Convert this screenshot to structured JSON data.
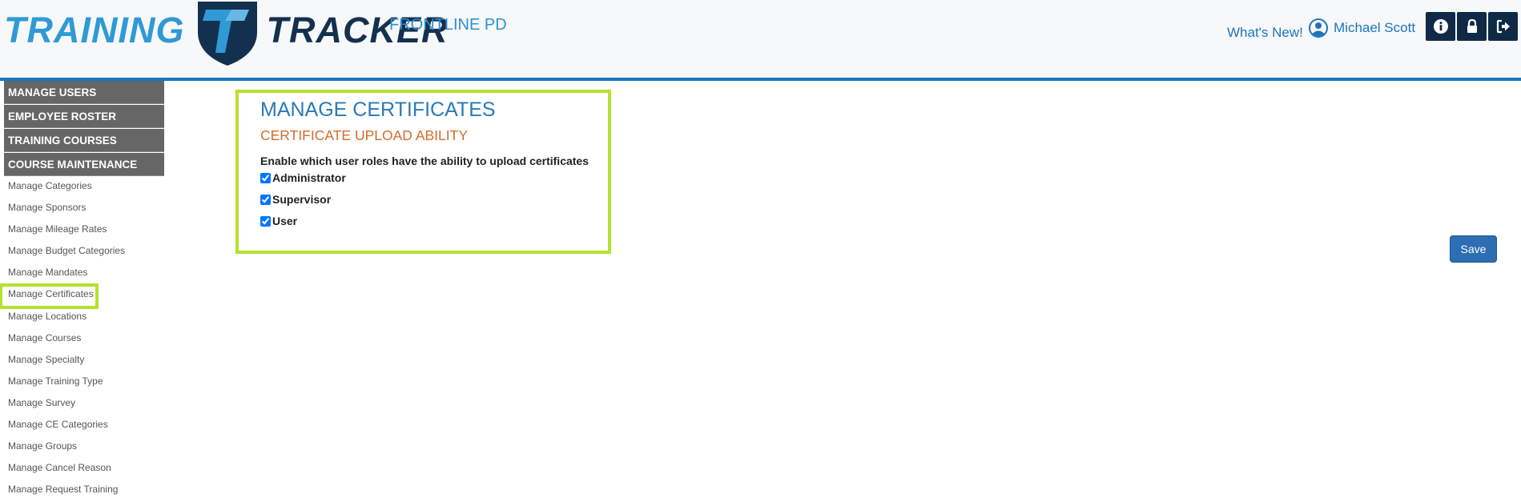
{
  "header": {
    "logo_left": "TRAINING",
    "logo_right": "TRACKER",
    "org_name": "FRONTLINE PD",
    "whats_new": "What's New!",
    "user_name": "Michael Scott",
    "buttons": [
      {
        "icon": "info-icon"
      },
      {
        "icon": "lock-icon"
      },
      {
        "icon": "logout-icon"
      }
    ]
  },
  "sidebar": {
    "sections": [
      {
        "label": "MANAGE USERS"
      },
      {
        "label": "EMPLOYEE ROSTER"
      },
      {
        "label": "TRAINING COURSES"
      },
      {
        "label": "COURSE MAINTENANCE"
      }
    ],
    "items": [
      {
        "label": "Manage Categories"
      },
      {
        "label": "Manage Sponsors"
      },
      {
        "label": "Manage Mileage Rates"
      },
      {
        "label": "Manage Budget Categories"
      },
      {
        "label": "Manage Mandates"
      },
      {
        "label": "Manage Certificates",
        "active": true
      },
      {
        "label": "Manage Locations"
      },
      {
        "label": "Manage Courses"
      },
      {
        "label": "Manage Specialty"
      },
      {
        "label": "Manage Training Type"
      },
      {
        "label": "Manage Survey"
      },
      {
        "label": "Manage CE Categories"
      },
      {
        "label": "Manage Groups"
      },
      {
        "label": "Manage Cancel Reason"
      },
      {
        "label": "Manage Request Training"
      }
    ]
  },
  "main": {
    "title": "MANAGE CERTIFICATES",
    "subtitle": "CERTIFICATE UPLOAD ABILITY",
    "description": "Enable which user roles have the ability to upload certificates",
    "roles": [
      {
        "label": "Administrator",
        "checked": true
      },
      {
        "label": "Supervisor",
        "checked": true
      },
      {
        "label": "User",
        "checked": true
      }
    ],
    "save_label": "Save"
  },
  "colors": {
    "accent_blue": "#1b75bb",
    "highlight_green": "#b5e22e",
    "subtitle_orange": "#d56d2c",
    "nav_dark": "#0f2a47",
    "sidebar_gray": "#666666"
  }
}
